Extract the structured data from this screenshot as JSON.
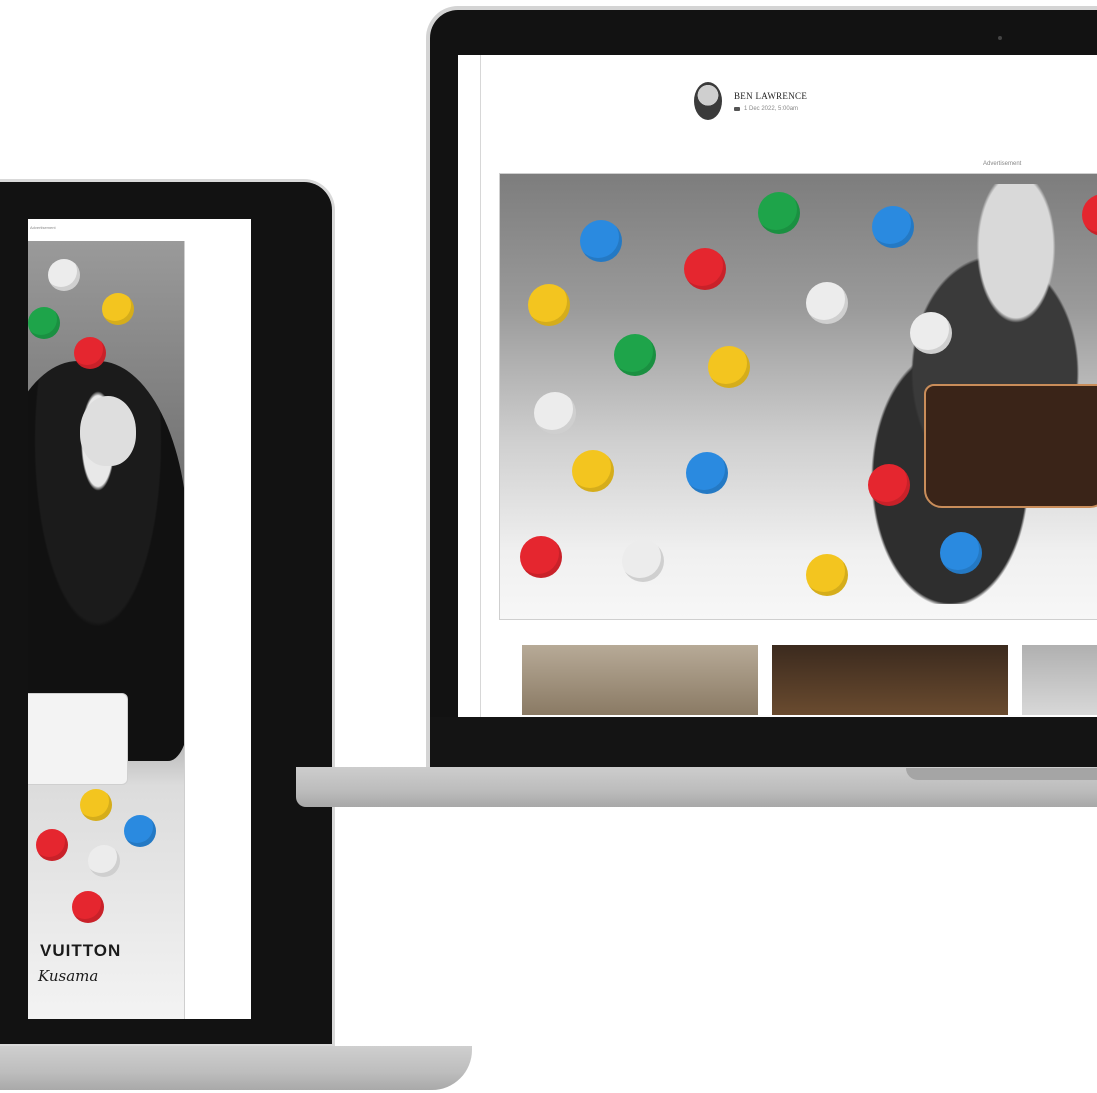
{
  "right_screen": {
    "author": {
      "name": "BEN LAWRENCE",
      "date": "1 Dec 2022, 5:00am"
    },
    "advertisement_label": "Advertisement",
    "thumbnails": [
      "vintage-group-photo",
      "restaurant-interior",
      "building-facade"
    ]
  },
  "left_screen": {
    "advertisement_label": "Advertisement",
    "brand_text": "VUITTON",
    "signature_text": "Kusama"
  },
  "colors": {
    "laptop_body": "#121212",
    "laptop_base": "#bdbdbd",
    "dot_red": "#e5262f",
    "dot_blue": "#2a8ae0",
    "dot_yellow": "#f3c51f",
    "dot_green": "#1ea44a",
    "dot_white": "#ececec"
  }
}
